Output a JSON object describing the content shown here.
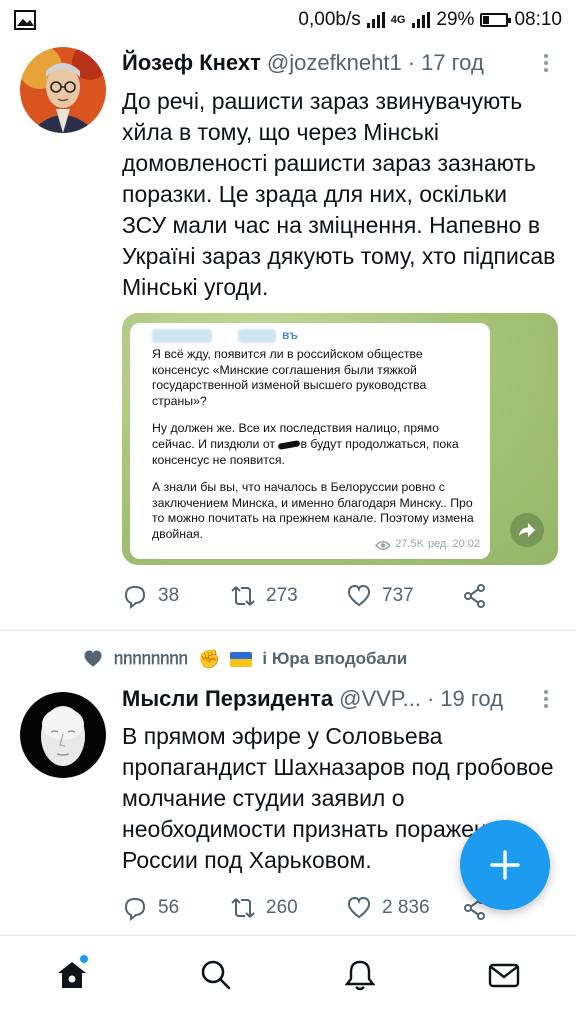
{
  "status_bar": {
    "speed": "0,00b/s",
    "network": "4G",
    "battery": "29%",
    "battery_level": 0.29,
    "time": "08:10"
  },
  "tweets": [
    {
      "name": "Йозеф Кнехт",
      "handle": "@jozefkneht1",
      "time": "17 год",
      "text": "До речі, рашисти зараз звинувачують хйла в тому, що через Мінські домовленості рашисти зараз зазнають поразки. Це зрада для них, оскільки ЗСУ мали час на зміцнення. Напевно в Україні зараз дякують тому, хто підписав Мінські угоди.",
      "media": {
        "sender_tail": "въ",
        "paragraph1": "Я всё жду, появится ли в российском обществе консенсус «Минские соглашения были тяжкой государственной изменой высшего руководства страны»?",
        "paragraph2_a": "Ну должен же. Все их последствия налицо, прямо сейчас. И пиздюли от",
        "paragraph2_b": "в будут продолжаться, пока консенсус не появится.",
        "paragraph3": "А знали бы вы, что началось в Белоруссии ровно с заключением Минска, и именно благодаря Минску.. Про то можно почитать на прежнем канале. Поэтому измена двойная.",
        "views": "27.5K",
        "edited": "ред. 20:02"
      },
      "replies": "38",
      "retweets": "273",
      "likes": "737"
    },
    {
      "context": "ᥒᥒᥒᥒᥒᥒᥒᥒ",
      "context_suffix": "і Юра вподобали",
      "name": "Мысли Перзидента",
      "handle": "@VVP...",
      "time": "19 год",
      "text": "В прямом эфире у Соловьева пропагандист Шахназаров под гробовое молчание студии заявил о необходимости признать поражение России под Харьковом.",
      "replies": "56",
      "retweets": "260",
      "likes": "2 836"
    }
  ],
  "colors": {
    "accent": "#1d9bf0",
    "secondary_text": "#536471",
    "divider": "#e6e9eb"
  },
  "icons": {
    "reply": "reply-icon",
    "retweet": "retweet-icon",
    "like": "heart-icon",
    "share": "share-icon",
    "compose": "plus-icon",
    "nav": [
      "home-icon",
      "search-icon",
      "notifications-icon",
      "messages-icon"
    ]
  }
}
